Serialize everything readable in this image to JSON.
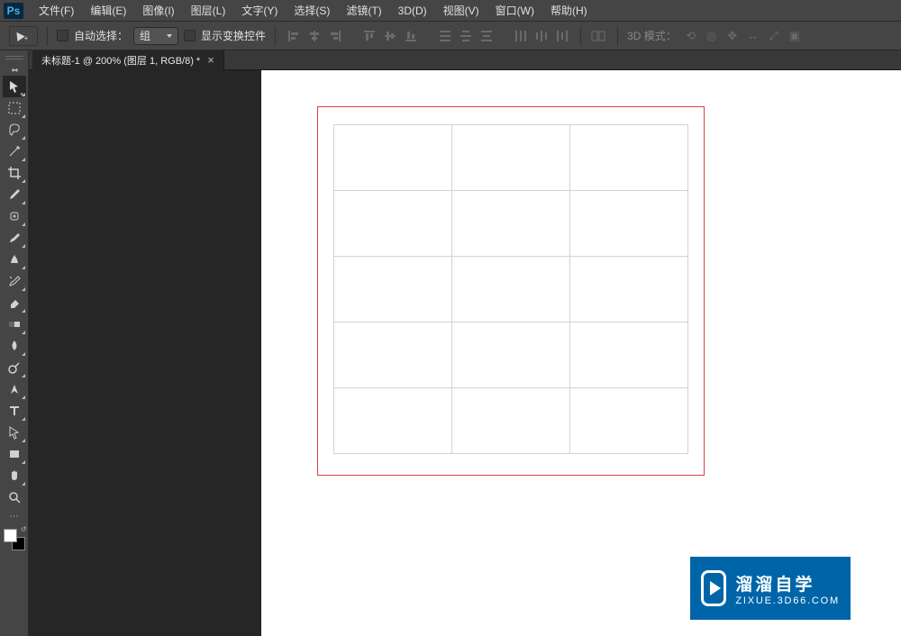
{
  "app": {
    "logo": "Ps"
  },
  "menu": {
    "items": [
      {
        "label": "文件(F)"
      },
      {
        "label": "编辑(E)"
      },
      {
        "label": "图像(I)"
      },
      {
        "label": "图层(L)"
      },
      {
        "label": "文字(Y)"
      },
      {
        "label": "选择(S)"
      },
      {
        "label": "滤镜(T)"
      },
      {
        "label": "3D(D)"
      },
      {
        "label": "视图(V)"
      },
      {
        "label": "窗口(W)"
      },
      {
        "label": "帮助(H)"
      }
    ]
  },
  "options": {
    "auto_select_label": "自动选择：",
    "auto_select_type": "组",
    "show_transform_label": "显示变换控件",
    "threeD_mode_label": "3D 模式："
  },
  "tabs": {
    "active": {
      "label": "未标题-1 @ 200% (图层 1, RGB/8) *"
    }
  },
  "watermark": {
    "main": "溜溜自学",
    "sub": "ZIXUE.3D66.COM"
  },
  "tools": [
    {
      "name": "move-tool",
      "active": true
    },
    {
      "name": "marquee-tool"
    },
    {
      "name": "lasso-tool"
    },
    {
      "name": "magic-wand-tool"
    },
    {
      "name": "crop-tool"
    },
    {
      "name": "eyedropper-tool"
    },
    {
      "name": "brush-tool"
    },
    {
      "name": "eraser-tool"
    },
    {
      "name": "clone-stamp-tool"
    },
    {
      "name": "history-brush-tool"
    },
    {
      "name": "gradient-tool"
    },
    {
      "name": "smudge-tool"
    },
    {
      "name": "blur-tool"
    },
    {
      "name": "dodge-tool"
    },
    {
      "name": "pen-tool"
    },
    {
      "name": "type-tool"
    },
    {
      "name": "path-selection-tool"
    },
    {
      "name": "rectangle-tool"
    },
    {
      "name": "hand-tool"
    },
    {
      "name": "zoom-tool"
    }
  ],
  "align_icons": [
    "align-left",
    "align-hcenter",
    "align-right",
    "align-top",
    "align-vcenter",
    "align-bottom",
    "distribute-h",
    "distribute-hc",
    "distribute-hr",
    "distribute-v",
    "distribute-vc",
    "distribute-vr",
    "auto-align"
  ],
  "threeD_icons": [
    "orbit-icon",
    "roll-icon",
    "pan-icon",
    "zoom-icon",
    "home-icon",
    "cam-icon"
  ]
}
